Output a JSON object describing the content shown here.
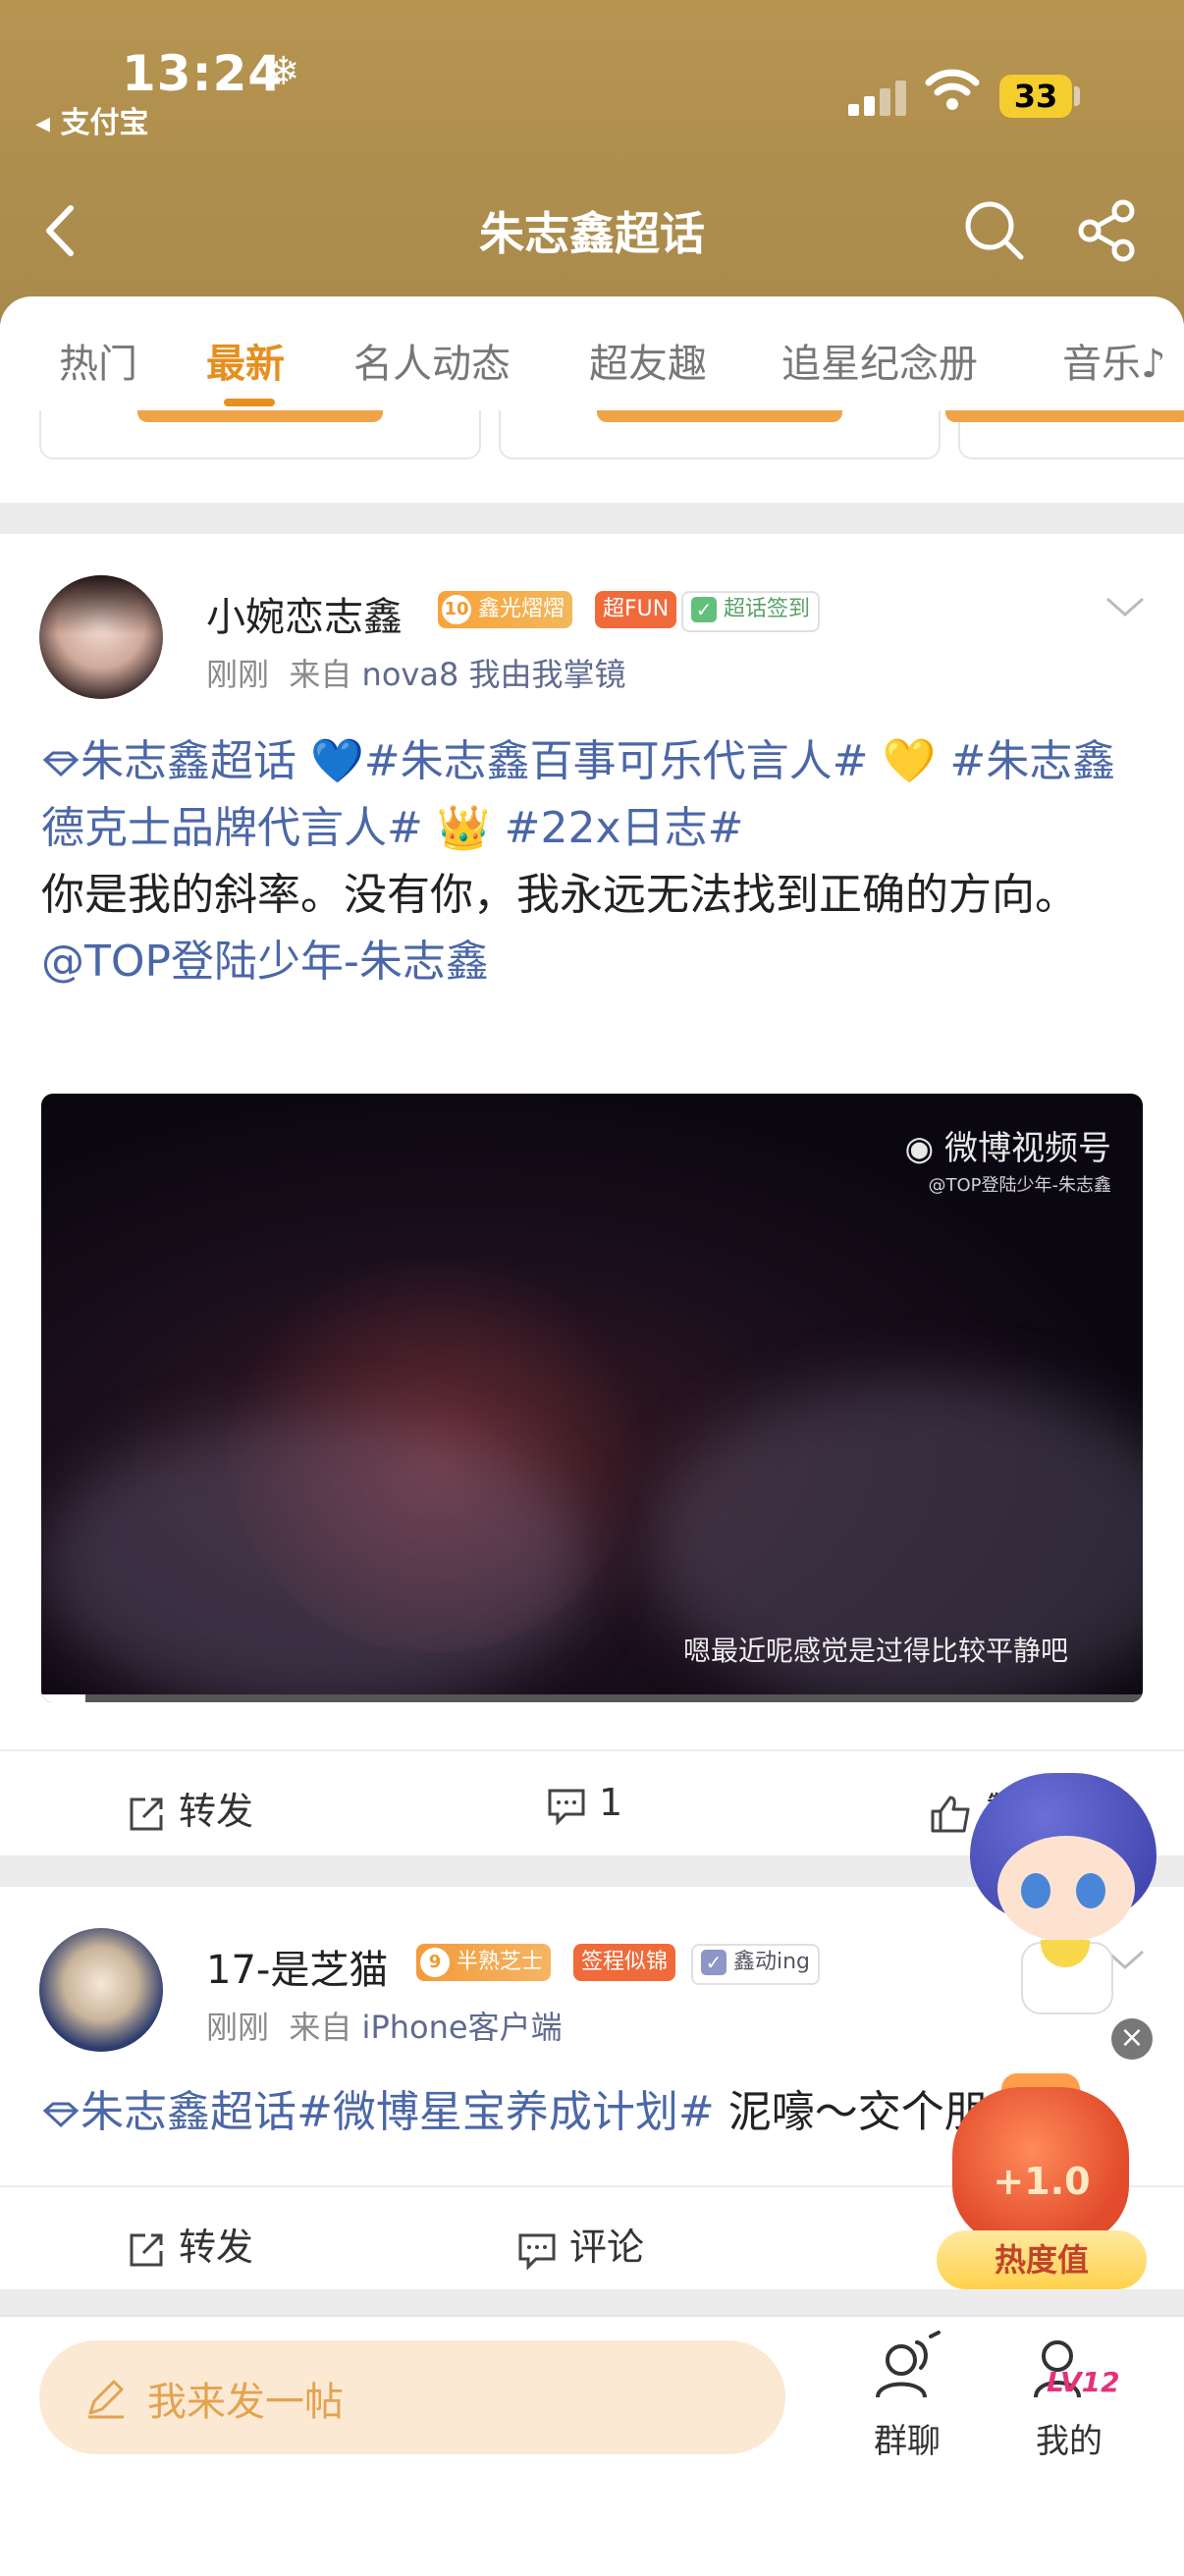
{
  "status_bar": {
    "time": "13:24",
    "back_app": "支付宝",
    "battery": "33"
  },
  "nav": {
    "title": "朱志鑫超话"
  },
  "tabs": [
    "热门",
    "最新",
    "名人动态",
    "超友趣",
    "追星纪念册",
    "音乐♪"
  ],
  "active_tab": "最新",
  "posts": [
    {
      "username": "小婉恋志鑫",
      "badges": {
        "level": "10",
        "fan": "鑫光熠熠",
        "fun": "超FUN",
        "checkin": "超话签到"
      },
      "time": "刚刚",
      "source_prefix": "来自",
      "source": "nova8 我由我掌镜",
      "content": {
        "topic": "朱志鑫超话",
        "heart_blue": "💙",
        "tag1": "#朱志鑫百事可乐代言人#",
        "heart_yellow": "💛",
        "tag2": "#朱志鑫德克士品牌代言人#",
        "crown": "👑",
        "tag3": "#22x日志#",
        "text": "你是我的斜率。没有你，我永远无法找到正确的方向。",
        "mention": "@TOP登陆少年-朱志鑫"
      },
      "video": {
        "watermark": "微博视频号",
        "watermark_sub": "@TOP登陆少年-朱志鑫",
        "subtitle": "嗯最近呢感觉是过得比较平静吧",
        "progress": 0.04
      },
      "actions": {
        "repost": "转发",
        "comment": "1",
        "like": "赞"
      }
    },
    {
      "username": "17-是芝猫",
      "badges": {
        "level": "9",
        "fan": "半熟芝士",
        "role": "签程似锦",
        "checkin": "鑫动ing"
      },
      "time": "刚刚",
      "source_prefix": "来自",
      "source": "iPhone客户端",
      "content": {
        "topic": "朱志鑫超话",
        "tag1": "#微博星宝养成计划#",
        "text": " 泥嚎～交个朋友吧"
      },
      "actions": {
        "repost": "转发",
        "comment": "评论"
      }
    }
  ],
  "heat": {
    "value": "+1.0",
    "label": "热度值"
  },
  "bottom": {
    "compose": "我来发一帖",
    "group_chat": "群聊",
    "mine": "我的",
    "level": "LV12"
  },
  "colors": {
    "header": "#b08d4e",
    "accent": "#e8901f",
    "link": "#4b67a8"
  }
}
